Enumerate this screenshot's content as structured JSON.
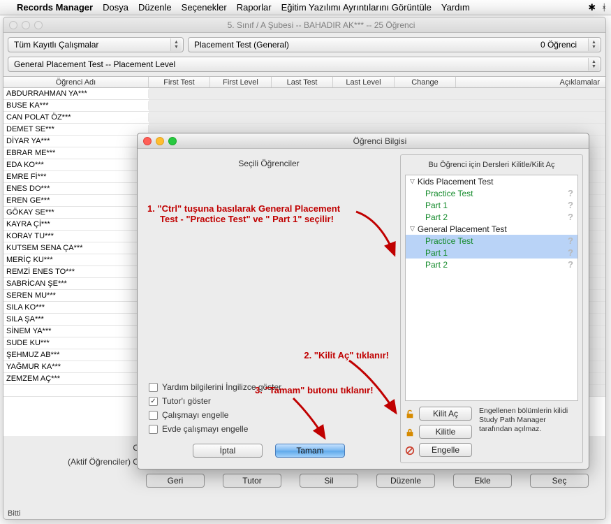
{
  "menubar": {
    "apple": "",
    "app": "Records Manager",
    "items": [
      "Dosya",
      "Düzenle",
      "Seçenekler",
      "Raporlar",
      "Eğitim Yazılımı Ayrıntılarını Görüntüle",
      "Yardım"
    ],
    "right_icons": [
      "✱",
      "ᚼ"
    ]
  },
  "window": {
    "title": "5. Sınıf / A Şubesi -- BAHADIR AK*** -- 25 Öğrenci",
    "popup1": "Tüm Kayıtlı Çalışmalar",
    "popup2_left": "Placement Test (General)",
    "popup2_right": "0 Öğrenci",
    "popup3": "General Placement Test   --   Placement Level",
    "columns": {
      "name": "Öğrenci Adı",
      "first_test": "First Test",
      "first_level": "First Level",
      "last_test": "Last Test",
      "last_level": "Last Level",
      "change": "Change",
      "desc": "Açıklamalar"
    },
    "students": [
      "ABDURRAHMAN YA***",
      "BUSE KA***",
      "CAN POLAT ÖZ***",
      "DEMET SE***",
      "DİYAR YA***",
      "EBRAR ME***",
      "EDA KO***",
      "EMRE Fİ***",
      "ENES DO***",
      "EREN GE***",
      "GÖKAY SE***",
      "KAYRA Çİ***",
      "KORAY TU***",
      "KUTSEM SENA ÇA***",
      "MERİÇ KU***",
      "REMZİ ENES TO***",
      "SABRİCAN ŞE***",
      "SEREN MU***",
      "SILA KO***",
      "SILA ŞA***",
      "SİNEM YA***",
      "SUDE KU***",
      "ŞEHMUZ AB***",
      "YAĞMUR KA***",
      "ZEMZEM AÇ***"
    ],
    "avg_label": "Ortalama:",
    "active_avg_label": "(Aktif Öğrenciler) Ortalama:",
    "buttons": [
      "Geri",
      "Tutor",
      "Sil",
      "Düzenle",
      "Ekle",
      "Seç"
    ],
    "status": "Bitti"
  },
  "dialog": {
    "title": "Öğrenci Bilgisi",
    "subtitle": "Seçili Öğrenciler",
    "checks": {
      "help_en": "Yardım bilgilerini İngilizce göster",
      "show_tutor": "Tutor'ı göster",
      "disable_work": "Çalışmayı engelle",
      "disable_home": "Evde çalışmayı engelle"
    },
    "show_tutor_checked": true,
    "cancel": "İptal",
    "ok": "Tamam",
    "panel_title": "Bu Öğrenci için Dersleri Kilitle/Kilit Aç",
    "tree": {
      "group1": "Kids Placement Test",
      "group1_children": [
        "Practice Test",
        "Part 1",
        "Part 2"
      ],
      "group2": "General Placement Test",
      "group2_children": [
        "Practice Test",
        "Part 1",
        "Part 2"
      ],
      "selected": [
        0,
        1
      ]
    },
    "lock_buttons": [
      "Kilit Aç",
      "Kilitle",
      "Engelle"
    ],
    "note": "Engellenen bölümlerin kilidi Study Path Manager tarafından açılmaz."
  },
  "annotations": {
    "a1_l1": "1. \"Ctrl\" tuşuna basılarak General Placement",
    "a1_l2": "Test - \"Practice Test\" ve  \" Part 1\" seçilir!",
    "a2": "2. \"Kilit Aç\" tıklanır!",
    "a3": "3. \"Tamam\" butonu tıklanır!"
  }
}
